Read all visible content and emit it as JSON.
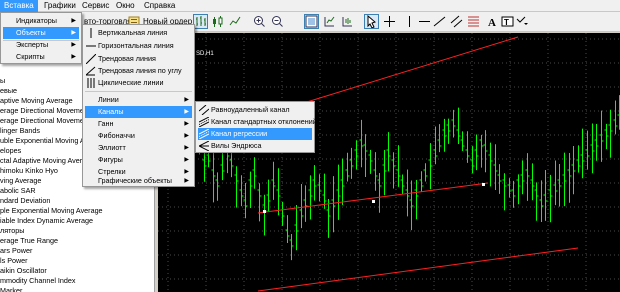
{
  "menubar": [
    "Вставка",
    "Графики",
    "Сервис",
    "Окно",
    "Справка"
  ],
  "toolbar": {
    "autotrade_label": "вто-торговля",
    "new_order_label": "Новый ордер"
  },
  "chart": {
    "title": "SD,H1"
  },
  "navigator": {
    "items": [
      "ы",
      "евые",
      "aptive Moving Average",
      "erage Directional Movement",
      "erage Directional Movement",
      "linger Bands",
      "uble Exponential Moving Av",
      "elopes",
      "ctal Adaptive Moving Average",
      "himoku Kinko Hyo",
      "ving Average",
      "abolic SAR",
      "ndard Deviation",
      "ple Exponential Moving Average",
      "iable Index Dynamic Average",
      "ляторы",
      "erage True Range",
      "ars Power",
      "ls Power",
      "aikin Oscillator",
      "mmodity Channel Index",
      "Marker"
    ]
  },
  "menu_insert": {
    "items": [
      "Индикаторы",
      "Объекты",
      "Эксперты",
      "Скрипты"
    ]
  },
  "menu_objects": {
    "items": [
      "Вертикальная линия",
      "Горизонтальная линия",
      "Трендовая линия",
      "Трендовая линия по углу",
      "Циклические линии",
      "Линии",
      "Каналы",
      "Ганн",
      "Фибоначчи",
      "Эллиотт",
      "Фигуры",
      "Стрелки",
      "Графические объекты"
    ]
  },
  "menu_channels": {
    "items": [
      "Равноудаленный канал",
      "Канал стандартных отклонений",
      "Канал регрессии",
      "Вилы Эндрюса"
    ]
  },
  "colors": {
    "highlight": "#3399ff",
    "candle": "#00ff00",
    "channel": "#ff2020",
    "grid": "#4a4a4a"
  }
}
